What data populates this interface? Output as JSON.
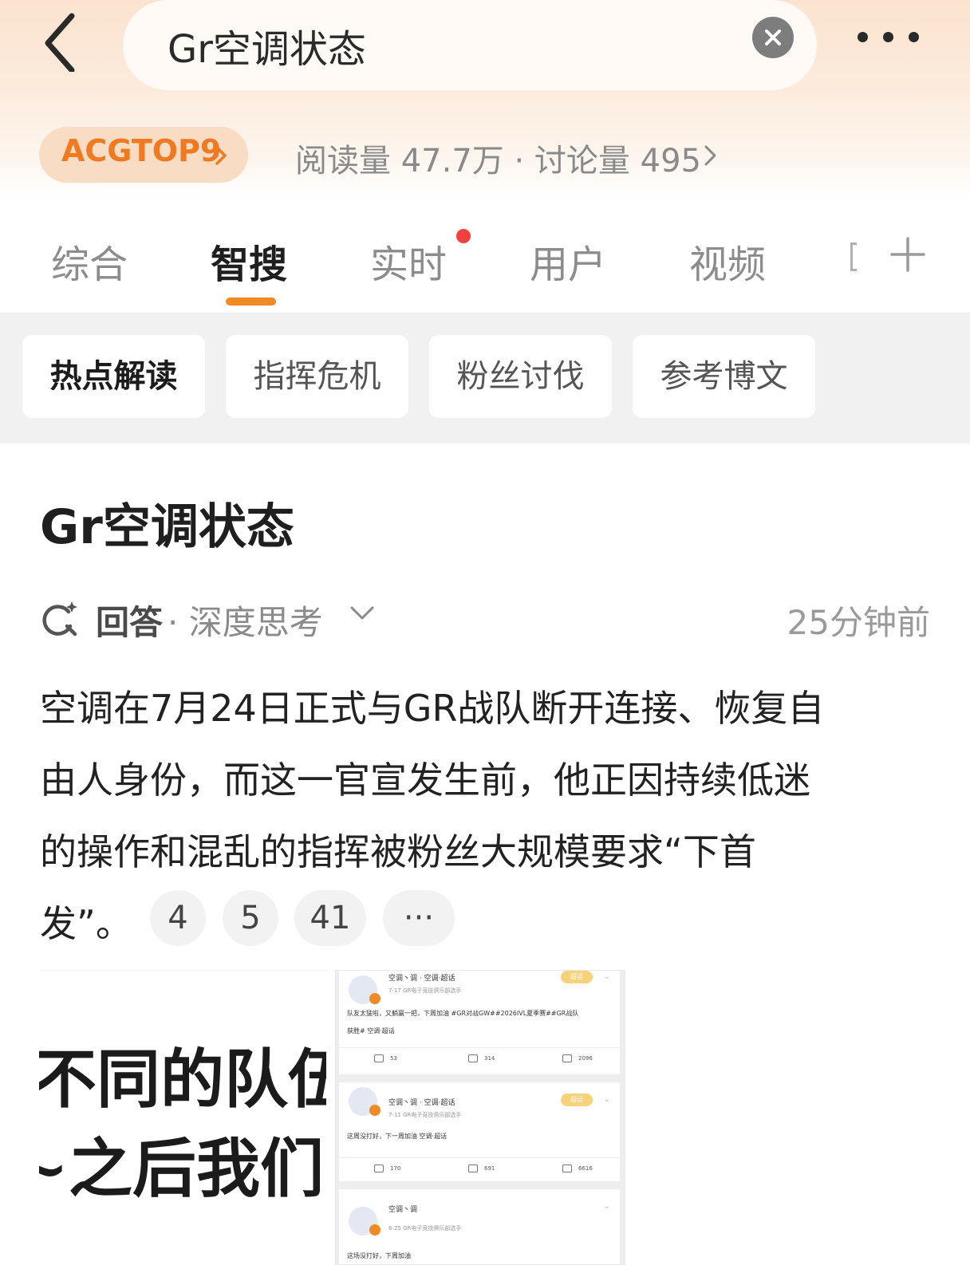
{
  "search": {
    "query": "Gr空调状态"
  },
  "topic": {
    "badge": "ACGTOP9",
    "stats": "阅读量 47.7万 · 讨论量 495"
  },
  "tabs": [
    "综合",
    "智搜",
    "实时",
    "用户",
    "视频"
  ],
  "active_tab": "智搜",
  "chips": [
    "热点解读",
    "指挥危机",
    "粉丝讨伐",
    "参考博文"
  ],
  "answer": {
    "title": "Gr空调状态",
    "label": "回答",
    "mode": "· 深度思考",
    "time": "25分钟前",
    "lines": [
      "空调在7月24日正式与GR战队断开连接、恢复自",
      "由人身份，而这一官宣发生前，他正因持续低迷",
      "的操作和混乱的指挥被粉丝大规模要求“下首",
      "发”。"
    ],
    "refs": [
      "4",
      "5",
      "41",
      "···"
    ]
  },
  "image1": {
    "line1": "不同的队伍,",
    "line2": "~之后我们"
  },
  "image2": {
    "posts": [
      {
        "name": "空调丶调 · 空调·超话",
        "sub": "7-17  GR电子竞技俱乐部选手",
        "body1": "队友太猛啦，又躺赢一把，下周加油 #GR对战GW##2026IVL夏季赛##GR战队",
        "body2": "获胜# 空调·超话",
        "tag": "超话",
        "repost": "53",
        "comment": "314",
        "like": "2096"
      },
      {
        "name": "空调丶调 · 空调·超话",
        "sub": "7-11  GR电子竞技俱乐部选手",
        "body1": "这周没打好，下一周加油 空调·超话",
        "body2": "",
        "tag": "超话",
        "repost": "170",
        "comment": "691",
        "like": "6616"
      },
      {
        "name": "空调丶调",
        "sub": "6-25  GR电子竞技俱乐部选手",
        "body1": "这场没打好，下周加油",
        "body2": "",
        "tag": "",
        "repost": "",
        "comment": "",
        "like": ""
      }
    ]
  },
  "colors": {
    "accent": "#f08a24",
    "badge_text": "#f07a22",
    "red_dot": "#f2403d"
  }
}
